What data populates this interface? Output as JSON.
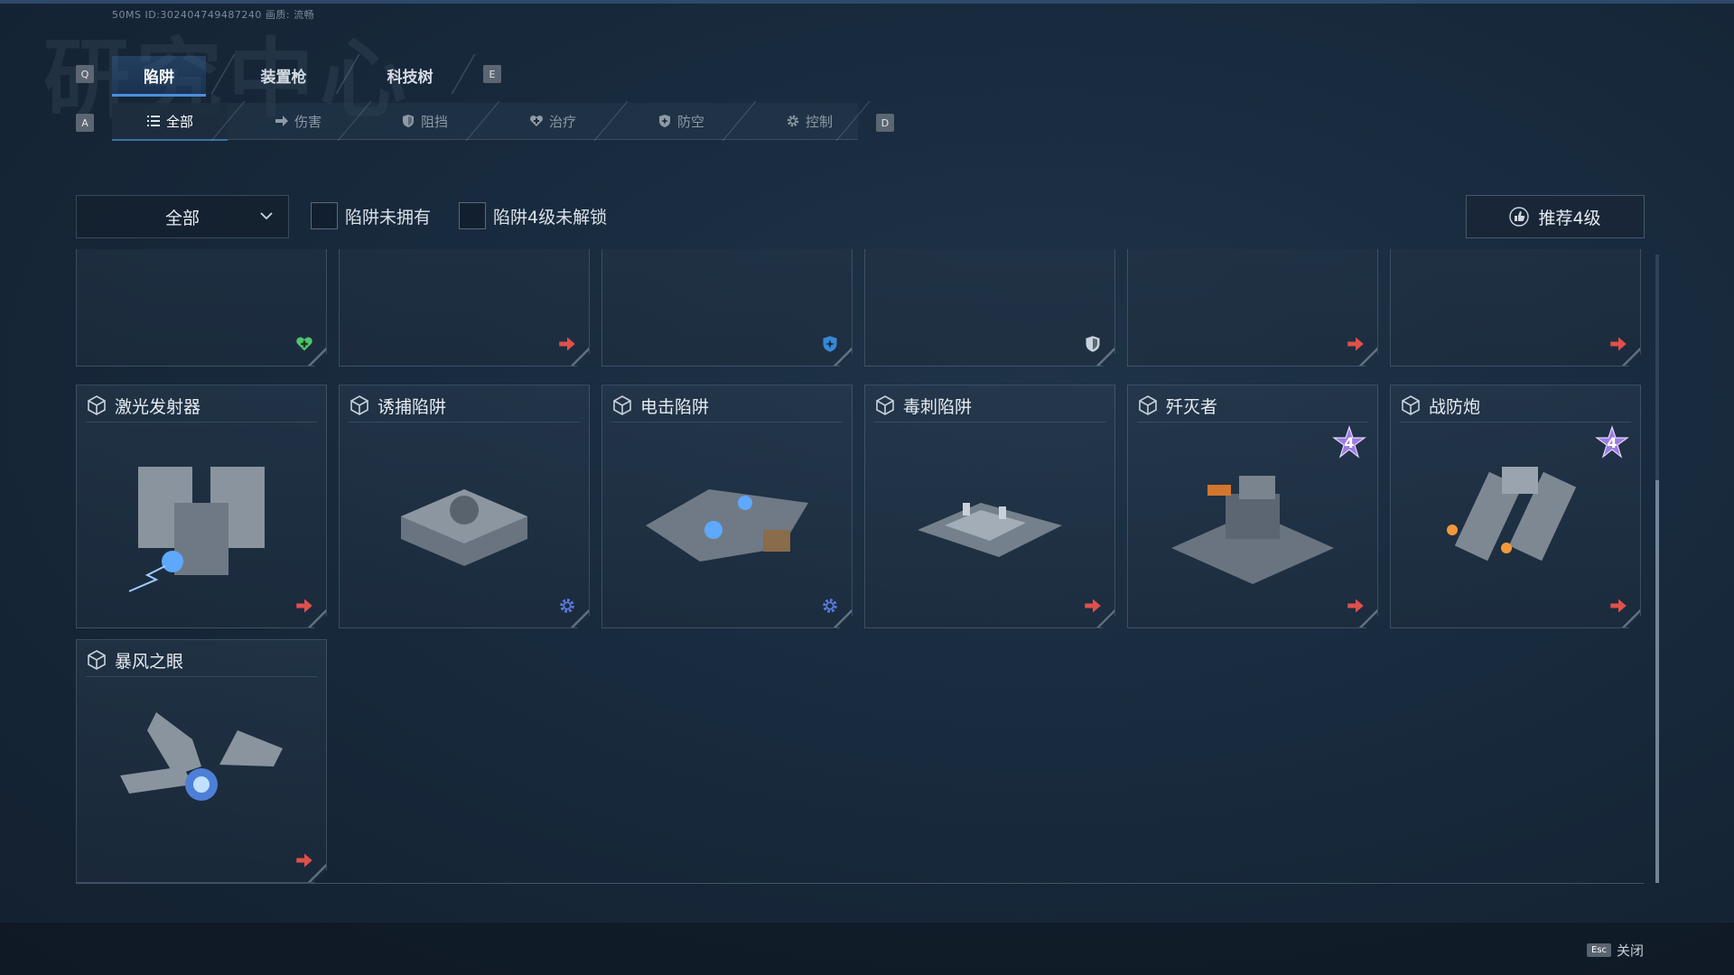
{
  "header": {
    "bg_title": "研究中心",
    "build_info": "50MS  ID:3024047494872​40   画质: 流畅",
    "key_prev": "Q",
    "key_next": "E",
    "tabs": [
      {
        "label": "陷阱",
        "sub": "",
        "active": true
      },
      {
        "label": "装置枪",
        "sub": "",
        "active": false
      },
      {
        "label": "科技树",
        "sub": "",
        "active": false
      }
    ]
  },
  "subnav": {
    "key_prev": "A",
    "key_next": "D",
    "tabs": [
      {
        "label": "全部",
        "icon": "list-icon",
        "active": true
      },
      {
        "label": "伤害",
        "icon": "arrow-right-icon",
        "active": false
      },
      {
        "label": "阻挡",
        "icon": "shield-icon",
        "active": false
      },
      {
        "label": "治疗",
        "icon": "heart-plus-icon",
        "active": false
      },
      {
        "label": "防空",
        "icon": "shield-plane-icon",
        "active": false
      },
      {
        "label": "控制",
        "icon": "gear-icon",
        "active": false
      }
    ]
  },
  "filters": {
    "dropdown_value": "全部",
    "checkbox_unowned": "陷阱未拥有",
    "checkbox_lv4_locked": "陷阱4级未解锁",
    "recommend_label": "推荐4级"
  },
  "top_row": [
    {
      "tag": "heal",
      "tag_icon": "heart-plus-icon",
      "tag_color": "#4fc46a"
    },
    {
      "tag": "damage",
      "tag_icon": "arrow-right-icon",
      "tag_color": "#e0504a"
    },
    {
      "tag": "anti-air",
      "tag_icon": "shield-plane-icon",
      "tag_color": "#3a88d6"
    },
    {
      "tag": "block",
      "tag_icon": "shield-icon",
      "tag_color": "#c9d2dc"
    },
    {
      "tag": "damage",
      "tag_icon": "arrow-right-icon",
      "tag_color": "#e0504a"
    },
    {
      "tag": "damage",
      "tag_icon": "arrow-right-icon",
      "tag_color": "#e0504a"
    }
  ],
  "cards": [
    {
      "name": "激光发射器",
      "tag": "damage",
      "tag_icon": "arrow-right-icon",
      "tag_color": "#e0504a",
      "level4": false
    },
    {
      "name": "诱捕陷阱",
      "tag": "control",
      "tag_icon": "gear-icon",
      "tag_color": "#5a7be0",
      "level4": false
    },
    {
      "name": "电击陷阱",
      "tag": "control",
      "tag_icon": "gear-icon",
      "tag_color": "#5a7be0",
      "level4": false
    },
    {
      "name": "毒刺陷阱",
      "tag": "damage",
      "tag_icon": "arrow-right-icon",
      "tag_color": "#e0504a",
      "level4": false
    },
    {
      "name": "歼灭者",
      "tag": "damage",
      "tag_icon": "arrow-right-icon",
      "tag_color": "#e0504a",
      "level4": true,
      "level_badge": "4"
    },
    {
      "name": "战防炮",
      "tag": "damage",
      "tag_icon": "arrow-right-icon",
      "tag_color": "#e0504a",
      "level4": true,
      "level_badge": "4"
    },
    {
      "name": "暴风之眼",
      "tag": "damage",
      "tag_icon": "arrow-right-icon",
      "tag_color": "#e0504a",
      "level4": false
    }
  ],
  "footer": {
    "esc_key": "Esc",
    "close_label": "关闭"
  }
}
